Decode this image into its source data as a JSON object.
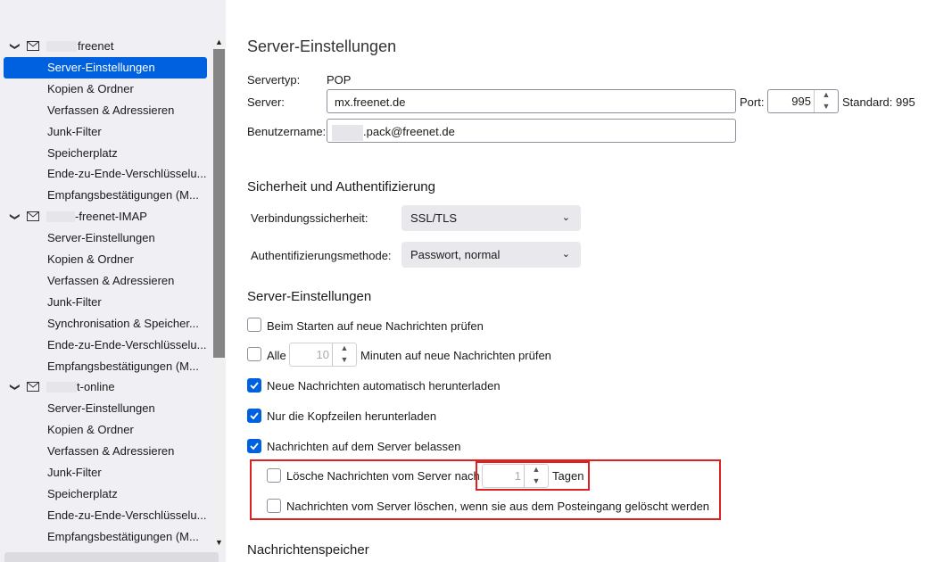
{
  "sidebar": {
    "accounts": [
      {
        "name": "freenet",
        "items": [
          "Server-Einstellungen",
          "Kopien & Ordner",
          "Verfassen & Adressieren",
          "Junk-Filter",
          "Speicherplatz",
          "Ende-zu-Ende-Verschlüsselu...",
          "Empfangsbestätigungen (M..."
        ]
      },
      {
        "name": "-freenet-IMAP",
        "items": [
          "Server-Einstellungen",
          "Kopien & Ordner",
          "Verfassen & Adressieren",
          "Junk-Filter",
          "Synchronisation & Speicher...",
          "Ende-zu-Ende-Verschlüsselu...",
          "Empfangsbestätigungen (M..."
        ]
      },
      {
        "name": "t-online",
        "items": [
          "Server-Einstellungen",
          "Kopien & Ordner",
          "Verfassen & Adressieren",
          "Junk-Filter",
          "Speicherplatz",
          "Ende-zu-Ende-Verschlüsselu...",
          "Empfangsbestätigungen (M..."
        ]
      }
    ]
  },
  "main": {
    "title": "Server-Einstellungen",
    "servertype_label": "Servertyp:",
    "servertype_value": "POP",
    "server_label": "Server:",
    "server_value": "mx.freenet.de",
    "port_label": "Port:",
    "port_value": "995",
    "standard_label": "Standard: 995",
    "username_label": "Benutzername:",
    "username_value": ".pack@freenet.de",
    "security_heading": "Sicherheit und Authentifizierung",
    "conn_security_label": "Verbindungssicherheit:",
    "conn_security_value": "SSL/TLS",
    "auth_label": "Authentifizierungsmethode:",
    "auth_value": "Passwort, normal",
    "server_settings_heading": "Server-Einstellungen",
    "check_on_start": "Beim Starten auf neue Nachrichten prüfen",
    "every_label": "Alle",
    "every_value": "10",
    "every_suffix": "Minuten auf neue Nachrichten prüfen",
    "auto_download": "Neue Nachrichten automatisch herunterladen",
    "headers_only": "Nur die Kopfzeilen herunterladen",
    "leave_on_server": "Nachrichten auf dem Server belassen",
    "delete_after_prefix": "Lösche Nachrichten vom Server nach",
    "delete_after_value": "1",
    "delete_after_suffix": "Tagen",
    "delete_when_removed": "Nachrichten vom Server löschen, wenn sie aus dem Posteingang gelöscht werden",
    "storage_heading": "Nachrichtenspeicher"
  },
  "colors": {
    "accent": "#0061e0",
    "highlight": "#e02020"
  }
}
